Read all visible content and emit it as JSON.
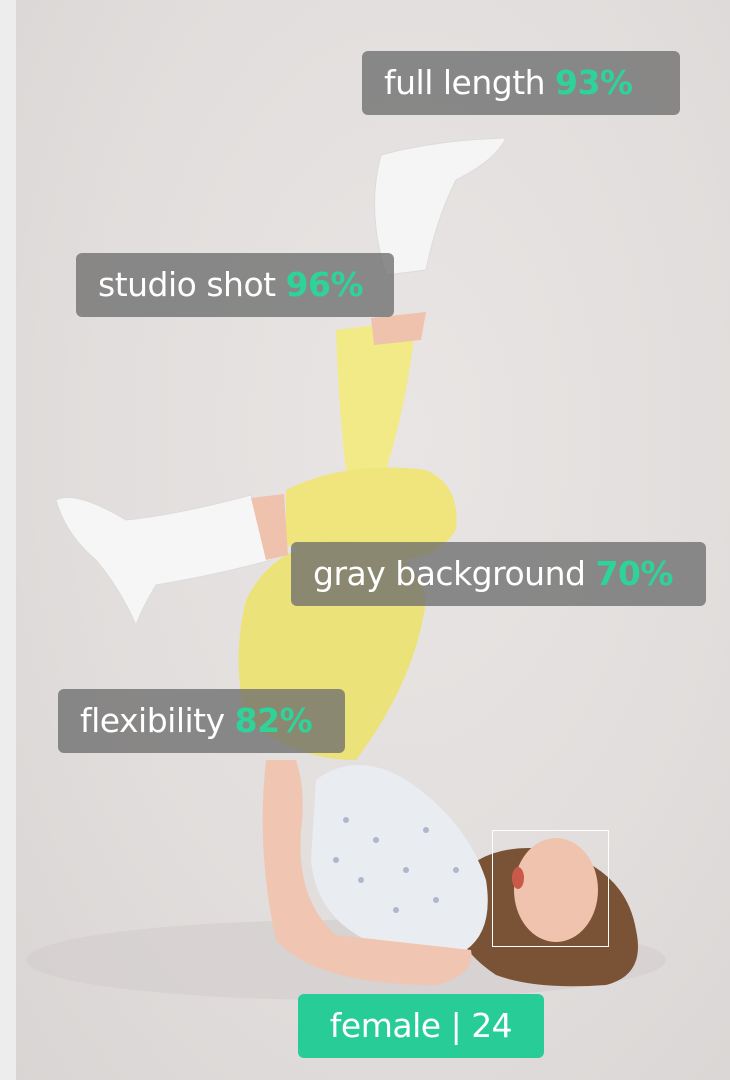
{
  "tags": [
    {
      "label": "full length",
      "percent": "93%"
    },
    {
      "label": "studio shot",
      "percent": "96%"
    },
    {
      "label": "gray background",
      "percent": "70%"
    },
    {
      "label": "flexibility",
      "percent": "82%"
    }
  ],
  "face": {
    "gender": "female",
    "separator": "|",
    "age": "24"
  },
  "colors": {
    "percent_accent": "#2ed39a",
    "badge_background": "#27cc96",
    "tag_background": "#6e6e6e"
  }
}
